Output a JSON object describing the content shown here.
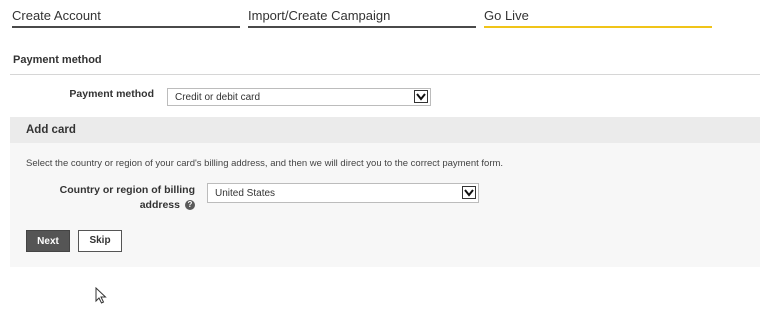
{
  "steps": [
    {
      "label": "Create Account"
    },
    {
      "label": "Import/Create Campaign"
    },
    {
      "label": "Go Live"
    }
  ],
  "payment_section": {
    "title": "Payment method",
    "field_label": "Payment method",
    "selected_value": "Credit or debit card"
  },
  "add_card": {
    "title": "Add card",
    "description": "Select the country or region of your card's billing address, and then we will direct you to the correct payment form.",
    "country_label_line1": "Country or region of billing",
    "country_label_line2": "address",
    "country_value": "United States",
    "next_label": "Next",
    "skip_label": "Skip"
  },
  "colors": {
    "active_step_underline": "#f0c419",
    "inactive_step_underline": "#4a4a4a",
    "panel_background": "#f7f7f7",
    "panel_header": "#ebebeb",
    "primary_button": "#555555"
  },
  "icons": {
    "dropdown": "chevron-down-icon",
    "help": "question-circle-icon",
    "cursor": "mouse-pointer-icon"
  }
}
